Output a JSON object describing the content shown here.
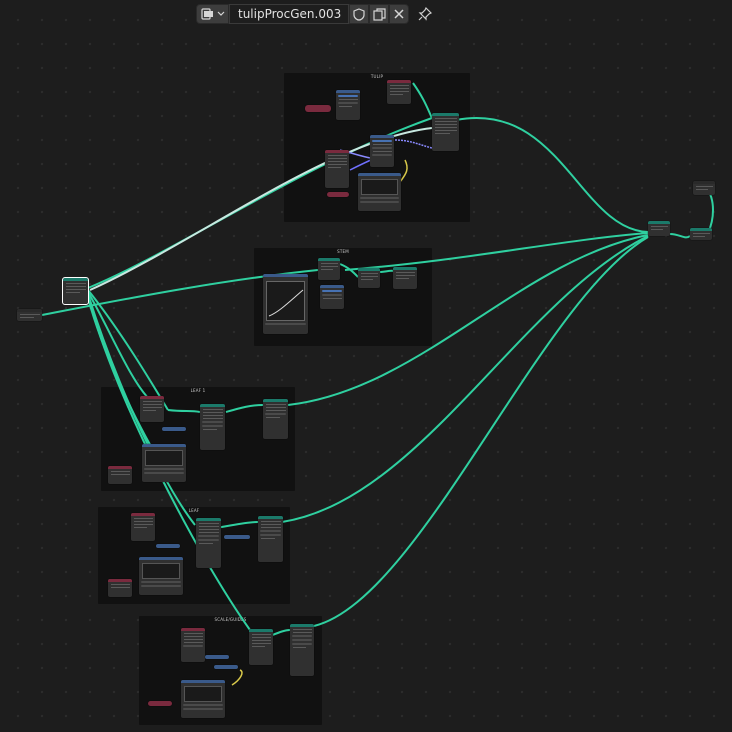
{
  "toolbar": {
    "browse_icon": "node-tree-icon",
    "name_value": "tulipProcGen.003",
    "fake_user_icon": "shield-icon",
    "duplicate_icon": "duplicate-icon",
    "unlink_icon": "close-icon",
    "pin_icon": "pin-icon"
  },
  "frames": {
    "tulip": "TULIP",
    "stem": "STEM",
    "leaf1": "LEAF 1",
    "leaf2": "LEAF",
    "scale": "SCALE/GUIDES"
  },
  "colors": {
    "background": "#1d1d1d",
    "frame": "#111111",
    "node_body": "#303030",
    "geometry_link": "#2fd0a0",
    "geometry_header": "#1b7a6a",
    "input_header": "#7a2a3e",
    "vector_header": "#3a5a8a",
    "float_link": "#8a8aff",
    "color_link": "#c8c8a0"
  }
}
